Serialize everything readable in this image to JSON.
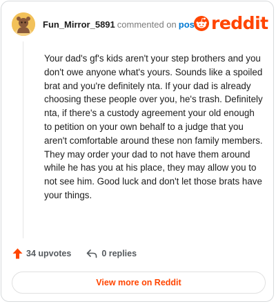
{
  "comment": {
    "username": "Fun_Mirror_5891",
    "commented_text": "commented on",
    "post_link": "post",
    "body": "Your dad's gf's kids aren't your step brothers and you don't owe anyone what's yours. Sounds like a spoiled brat and you're definitely nta. If your dad is already choosing these people over you, he's trash. Definitely nta, if there's a custody agreement your old enough to petition on your own behalf to a judge that you aren't comfortable around these non family members. They may order your dad to not have them around while he has you at his place, they may allow you to not see him. Good luck and don't let those brats have your things."
  },
  "brand": {
    "wordmark": "reddit",
    "color": "#ff4500"
  },
  "stats": {
    "upvotes": "34 upvotes",
    "replies": "0 replies"
  },
  "footer": {
    "view_more": "View more on Reddit"
  },
  "icons": {
    "avatar": "avatar-icon",
    "logo": "reddit-snoo-icon",
    "upvote": "upvote-arrow-icon",
    "reply": "reply-arrow-icon"
  }
}
